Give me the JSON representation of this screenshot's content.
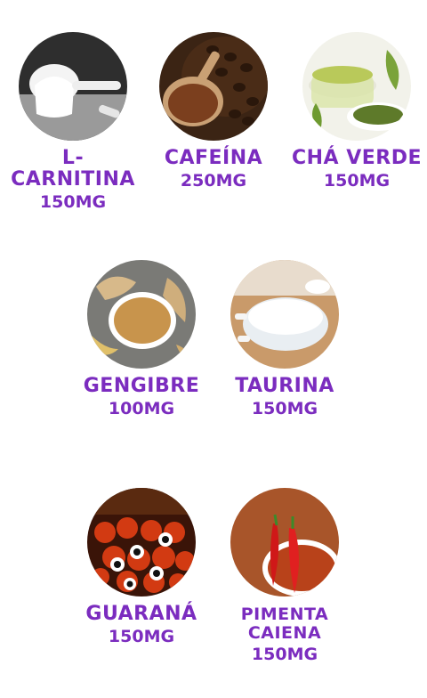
{
  "items": [
    {
      "name": "L-CARNITINA",
      "dose": "150MG",
      "icon": "powder-scoop-image"
    },
    {
      "name": "CAFEÍNA",
      "dose": "250MG",
      "icon": "coffee-beans-image"
    },
    {
      "name": "CHÁ VERDE",
      "dose": "150MG",
      "icon": "green-tea-image"
    },
    {
      "name": "GENGIBRE",
      "dose": "100MG",
      "icon": "ginger-powder-image"
    },
    {
      "name": "TAURINA",
      "dose": "150MG",
      "icon": "taurine-bowl-image"
    },
    {
      "name": "GUARANÁ",
      "dose": "150MG",
      "icon": "guarana-fruit-image"
    },
    {
      "name": "PIMENTA\nCAIENA",
      "dose": "150MG",
      "icon": "cayenne-pepper-image"
    }
  ],
  "colors": {
    "text": "#7b2cbf",
    "background": "#ffffff"
  }
}
